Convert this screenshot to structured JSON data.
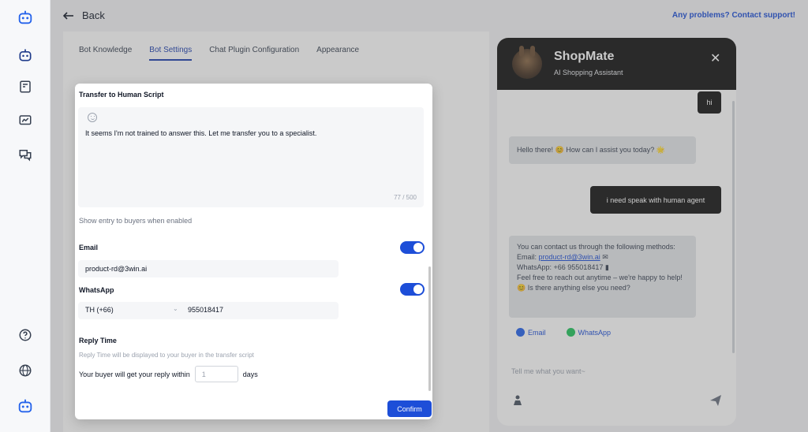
{
  "topbar": {
    "back_label": "Back",
    "support_link": "Any problems? Contact support!"
  },
  "tabs": [
    {
      "label": "Bot Knowledge",
      "active": false
    },
    {
      "label": "Bot Settings",
      "active": true
    },
    {
      "label": "Chat Plugin Configuration",
      "active": false
    },
    {
      "label": "Appearance",
      "active": false
    }
  ],
  "modal": {
    "title": "Transfer to Human Script",
    "script_text": "It seems I'm not trained to answer this. Let me transfer you to a specialist.",
    "char_count": "77 / 500",
    "show_entry_hint": "Show entry to buyers when enabled",
    "email": {
      "label": "Email",
      "value": "product-rd@3win.ai",
      "enabled": true
    },
    "whatsapp": {
      "label": "WhatsApp",
      "country": "TH (+66)",
      "phone": "955018417",
      "enabled": true
    },
    "reply_time": {
      "label": "Reply Time",
      "hint": "Reply Time will be displayed to your buyer in the transfer script",
      "prefix": "Your buyer will get your reply within",
      "placeholder": "1",
      "suffix": "days"
    },
    "confirm_label": "Confirm"
  },
  "chat": {
    "name": "ShopMate",
    "subtitle": "AI Shopping Assistant",
    "messages": {
      "user_hi": "hi",
      "bot_greeting": "Hello there! 😊 How can I assist you today? 🌟",
      "user_request": "i need speak with human agent",
      "bot_contact_intro": "You can contact us through the following methods:",
      "bot_contact_email_label": "Email:",
      "bot_contact_email": "product-rd@3win.ai",
      "bot_contact_whatsapp": "WhatsApp: +66 955018417",
      "bot_contact_outro": "Feel free to reach out anytime – we're happy to help! 😊 Is there anything else you need?"
    },
    "email_button": "Email",
    "whatsapp_button": "WhatsApp",
    "input_placeholder": "Tell me what you want~"
  },
  "colors": {
    "accent": "#1d4ed8",
    "chat_header": "#141414",
    "whatsapp": "#22c55e"
  }
}
